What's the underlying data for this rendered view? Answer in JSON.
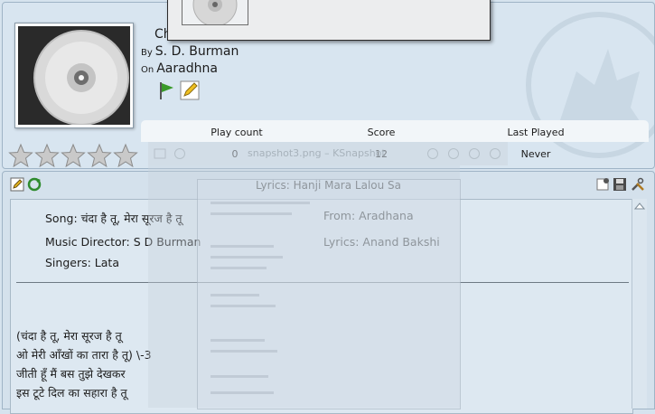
{
  "track": {
    "title_partial": "Ch",
    "by_prefix": "By",
    "artist": "S. D. Burman",
    "on_prefix": "On",
    "album": "Aaradhna"
  },
  "stats": {
    "headers": {
      "play_count": "Play count",
      "score": "Score",
      "last_played": "Last Played"
    },
    "values": {
      "play_count": "0",
      "score": "12",
      "last_played": "Never"
    }
  },
  "rating": {
    "stars_total": 5,
    "stars_filled": 0
  },
  "ghost": {
    "title": "snapshot3.png – KSnapshot"
  },
  "lyrics": {
    "header": "Lyrics: Hanji Mara Lalou Sa",
    "fields": {
      "song": "Song: चंदा है तू, मेरा सूरज है तू",
      "from": "From: Aradhana",
      "music_director": "Music Director: S D Burman",
      "lyricist": "Lyrics: Anand Bakshi",
      "singers": "Singers: Lata"
    },
    "lines": [
      "(चंदा है तू, मेरा सूरज है तू",
      "ओ मेरी आँखों का तारा है तू) \\-3",
      "जीती हूँ मैं बस तुझे देखकर",
      "इस टूटे दिल का सहारा है तू"
    ]
  },
  "colors": {
    "accent_green": "#3a9a2a",
    "panel_bg": "#d4e1ec"
  }
}
